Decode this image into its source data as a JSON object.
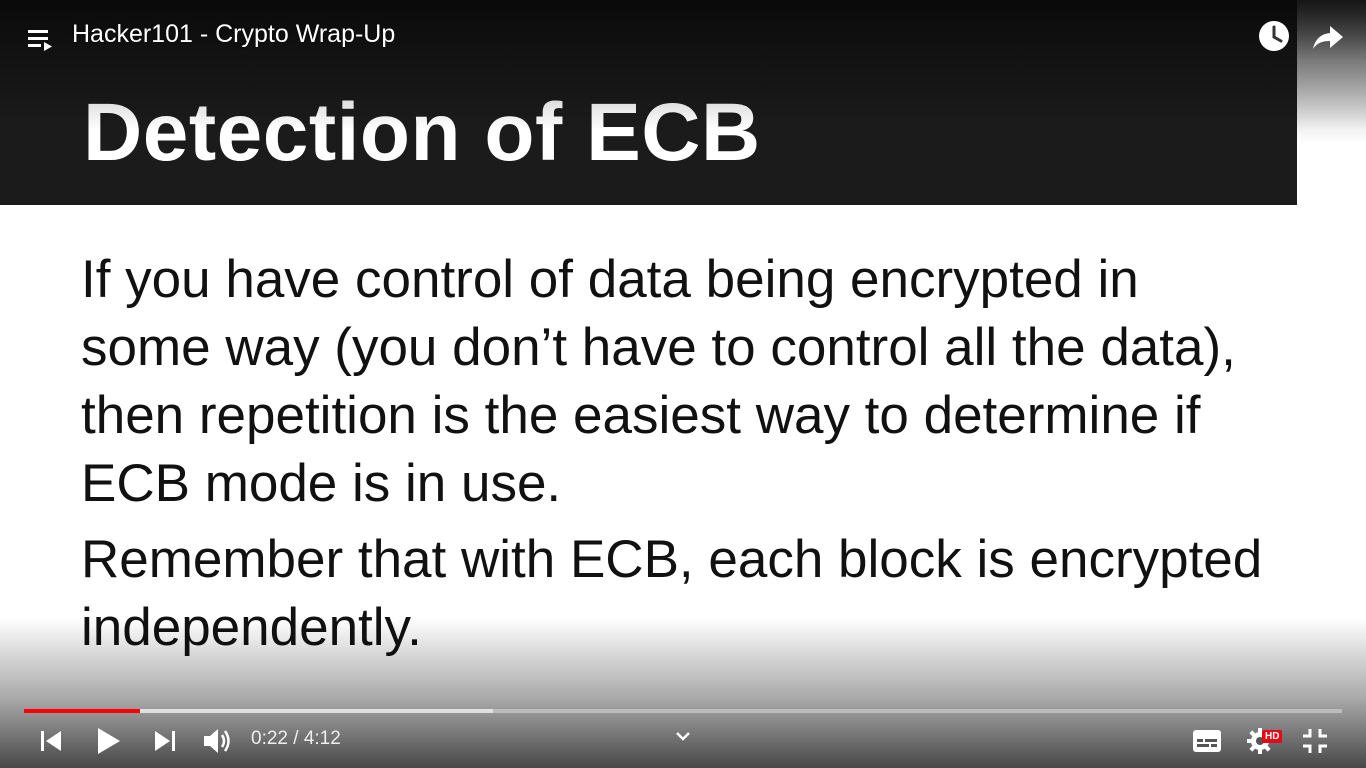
{
  "player": {
    "title": "Hacker101 - Crypto Wrap-Up",
    "time_current": "0:22",
    "time_separator": " / ",
    "time_total": "4:12",
    "progress_fraction": 0.088,
    "buffer_fraction": 0.356,
    "quality_badge": "HD",
    "accent_color": "#ff0000"
  },
  "slide": {
    "title": "Detection of ECB",
    "paragraphs": [
      "If you have control of data being encrypted in some way (you don’t have to control all the data), then repetition is the easiest way to determine if ECB mode is in use.",
      "Remember that with ECB, each block is encrypted independently."
    ]
  },
  "icons": {
    "playlist": "playlist-icon",
    "watch_later": "clock-icon",
    "share": "share-arrow-icon",
    "previous": "skip-previous-icon",
    "play": "play-icon",
    "next": "skip-next-icon",
    "volume": "volume-icon",
    "chevron": "chevron-down-icon",
    "subtitles": "subtitles-icon",
    "settings": "gear-icon",
    "exit_fullscreen": "exit-fullscreen-icon"
  }
}
